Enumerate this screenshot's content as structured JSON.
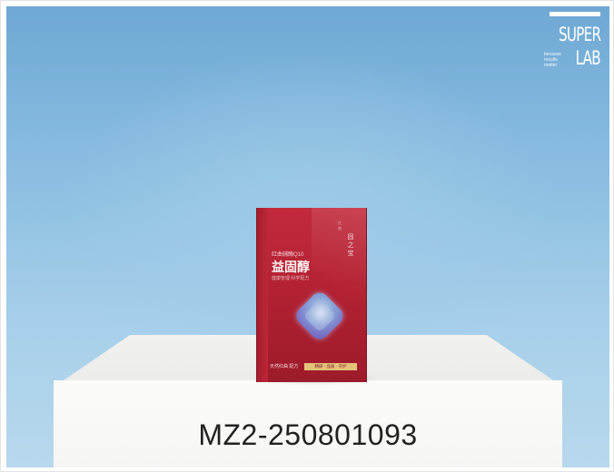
{
  "logo": {
    "super": "SUPER",
    "lab": "LAB",
    "tagline": [
      "because",
      "results",
      "matter"
    ]
  },
  "product": {
    "line1": "红曲辅酶Q10",
    "line2": "益固醇",
    "line3": "健康管理 科学配方",
    "vertical": "固之宝",
    "vertical_small": "红曲",
    "badge_left": "天然红曲 配方",
    "badge_right": "精研 · 品质 · 守护"
  },
  "sample_code": "MZ2-250801093",
  "colors": {
    "background": "#8ec0e2",
    "box": "#b32233",
    "pedestal": "#f6f6f5",
    "code_text": "#222222"
  },
  "icons": [
    "product-gem-icon"
  ]
}
